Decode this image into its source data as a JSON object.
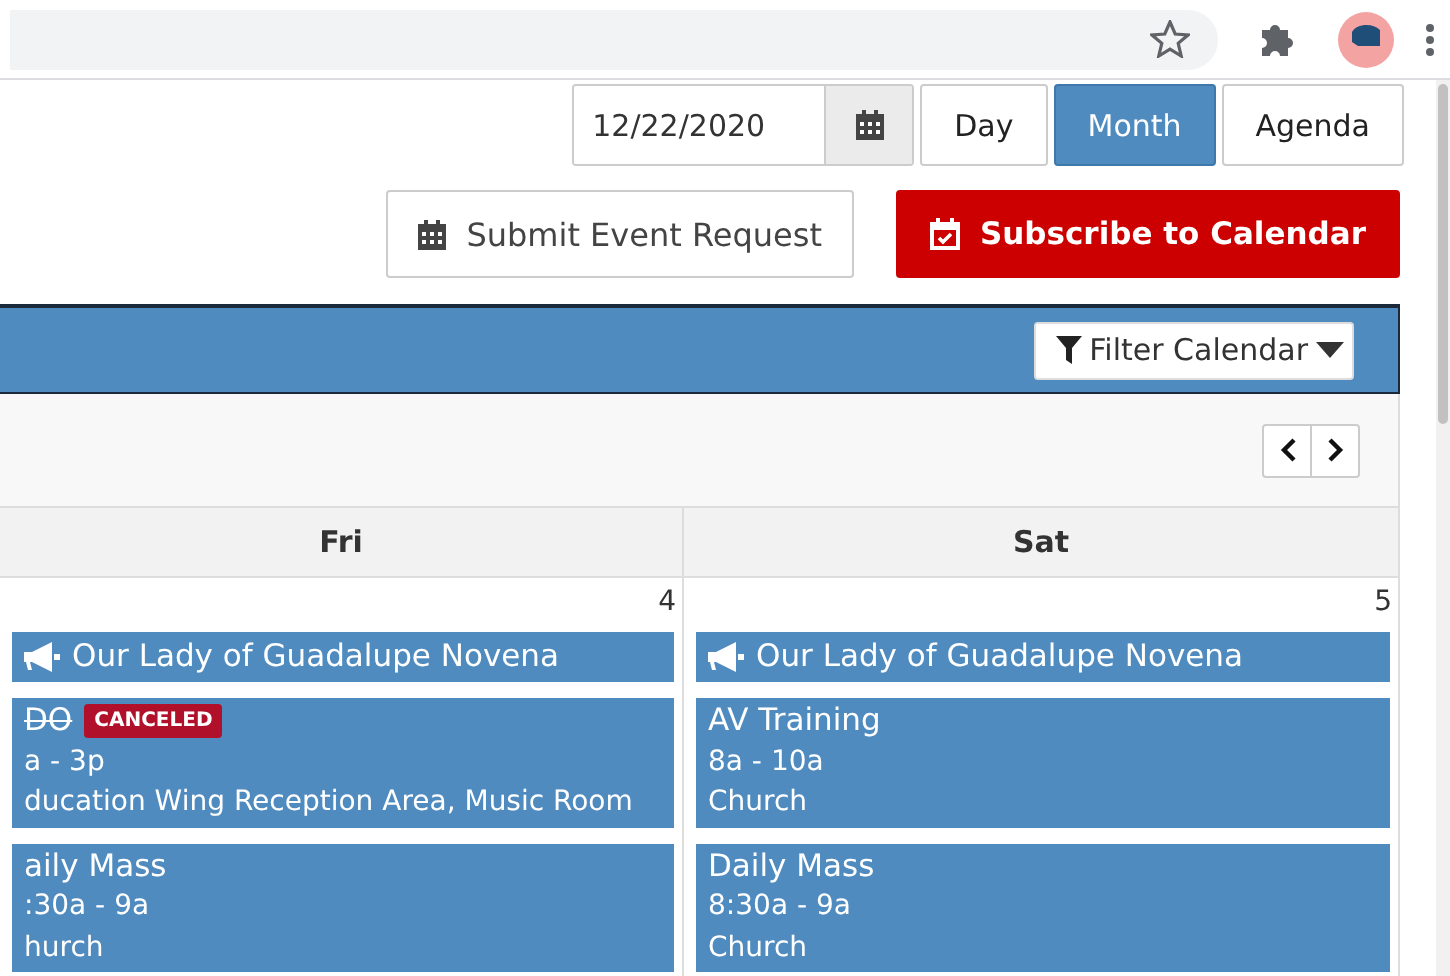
{
  "toolbar": {
    "date": "12/22/2020",
    "views": [
      {
        "label": "Day",
        "selected": false
      },
      {
        "label": "Month",
        "selected": true
      },
      {
        "label": "Agenda",
        "selected": false
      }
    ]
  },
  "actions": {
    "submit": "Submit Event Request",
    "subscribe": "Subscribe to Calendar"
  },
  "filter": {
    "label": "Filter Calendar"
  },
  "days": [
    {
      "name": "Fri",
      "number": "4",
      "events": [
        {
          "kind": "announcement",
          "title": "Our Lady of Guadalupe Novena"
        },
        {
          "kind": "event",
          "title": "DO",
          "canceled": true,
          "badge": "CANCELED",
          "time": "a - 3p",
          "location": "ducation Wing Reception Area, Music Room"
        },
        {
          "kind": "event",
          "title": "aily Mass",
          "canceled": false,
          "time": ":30a - 9a",
          "location": "hurch"
        }
      ]
    },
    {
      "name": "Sat",
      "number": "5",
      "events": [
        {
          "kind": "announcement",
          "title": "Our Lady of Guadalupe Novena"
        },
        {
          "kind": "event",
          "title": "AV Training",
          "canceled": false,
          "time": "8a - 10a",
          "location": "Church"
        },
        {
          "kind": "event",
          "title": "Daily Mass",
          "canceled": false,
          "time": "8:30a - 9a",
          "location": "Church"
        }
      ]
    }
  ]
}
